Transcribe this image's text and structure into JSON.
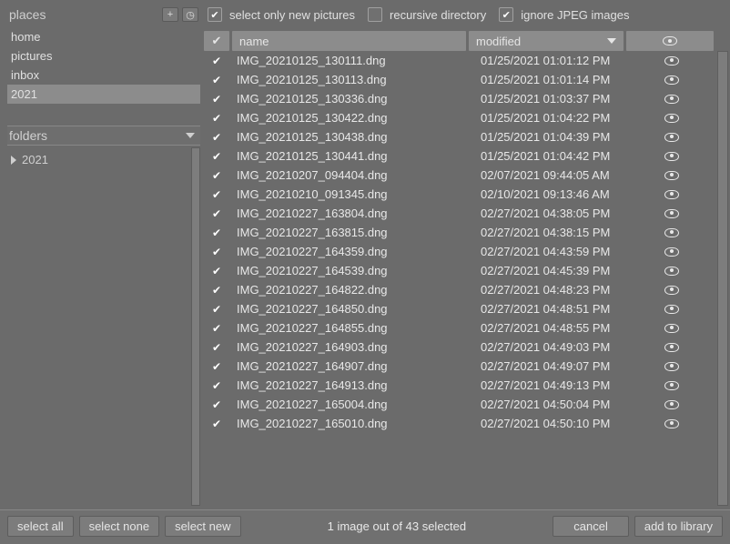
{
  "sidebar": {
    "places_title": "places",
    "add_btn": "+",
    "clock_btn": "◷",
    "places": [
      {
        "label": "home",
        "selected": false
      },
      {
        "label": "pictures",
        "selected": false
      },
      {
        "label": "inbox",
        "selected": false
      },
      {
        "label": "2021",
        "selected": true
      }
    ],
    "folders_title": "folders",
    "folders": [
      {
        "label": "2021"
      }
    ]
  },
  "options": {
    "select_new": {
      "label": "select only new pictures",
      "checked": true
    },
    "recursive": {
      "label": "recursive directory",
      "checked": false
    },
    "ignore_jpeg": {
      "label": "ignore JPEG images",
      "checked": true
    }
  },
  "table": {
    "headers": {
      "check": "✔",
      "name": "name",
      "modified": "modified"
    },
    "rows": [
      {
        "checked": true,
        "name": "IMG_20210125_130111.dng",
        "modified": "01/25/2021 01:01:12 PM"
      },
      {
        "checked": true,
        "name": "IMG_20210125_130113.dng",
        "modified": "01/25/2021 01:01:14 PM"
      },
      {
        "checked": true,
        "name": "IMG_20210125_130336.dng",
        "modified": "01/25/2021 01:03:37 PM"
      },
      {
        "checked": true,
        "name": "IMG_20210125_130422.dng",
        "modified": "01/25/2021 01:04:22 PM"
      },
      {
        "checked": true,
        "name": "IMG_20210125_130438.dng",
        "modified": "01/25/2021 01:04:39 PM"
      },
      {
        "checked": true,
        "name": "IMG_20210125_130441.dng",
        "modified": "01/25/2021 01:04:42 PM"
      },
      {
        "checked": true,
        "name": "IMG_20210207_094404.dng",
        "modified": "02/07/2021 09:44:05 AM"
      },
      {
        "checked": true,
        "name": "IMG_20210210_091345.dng",
        "modified": "02/10/2021 09:13:46 AM"
      },
      {
        "checked": true,
        "name": "IMG_20210227_163804.dng",
        "modified": "02/27/2021 04:38:05 PM"
      },
      {
        "checked": true,
        "name": "IMG_20210227_163815.dng",
        "modified": "02/27/2021 04:38:15 PM"
      },
      {
        "checked": true,
        "name": "IMG_20210227_164359.dng",
        "modified": "02/27/2021 04:43:59 PM"
      },
      {
        "checked": true,
        "name": "IMG_20210227_164539.dng",
        "modified": "02/27/2021 04:45:39 PM"
      },
      {
        "checked": true,
        "name": "IMG_20210227_164822.dng",
        "modified": "02/27/2021 04:48:23 PM"
      },
      {
        "checked": true,
        "name": "IMG_20210227_164850.dng",
        "modified": "02/27/2021 04:48:51 PM"
      },
      {
        "checked": true,
        "name": "IMG_20210227_164855.dng",
        "modified": "02/27/2021 04:48:55 PM"
      },
      {
        "checked": true,
        "name": "IMG_20210227_164903.dng",
        "modified": "02/27/2021 04:49:03 PM"
      },
      {
        "checked": true,
        "name": "IMG_20210227_164907.dng",
        "modified": "02/27/2021 04:49:07 PM"
      },
      {
        "checked": true,
        "name": "IMG_20210227_164913.dng",
        "modified": "02/27/2021 04:49:13 PM"
      },
      {
        "checked": true,
        "name": "IMG_20210227_165004.dng",
        "modified": "02/27/2021 04:50:04 PM"
      },
      {
        "checked": true,
        "name": "IMG_20210227_165010.dng",
        "modified": "02/27/2021 04:50:10 PM"
      }
    ]
  },
  "footer": {
    "select_all": "select all",
    "select_none": "select none",
    "select_new": "select new",
    "status": "1 image out of 43 selected",
    "cancel": "cancel",
    "add": "add to library"
  }
}
